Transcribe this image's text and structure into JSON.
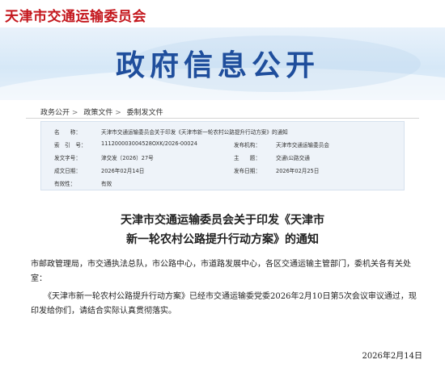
{
  "header": {
    "site_name": "天津市交通运输委员会",
    "banner_title": "政府信息公开"
  },
  "breadcrumb": {
    "items": [
      "政务公开",
      "政策文件",
      "委制发文件"
    ],
    "separator": ">"
  },
  "metadata": {
    "name_label": "名　　称：",
    "name_value": "天津市交通运输委员会关于印发《天津市新一轮农村公路提升行动方案》的通知",
    "index_label": "索　引　号：",
    "index_value": "111200003004528OXK/2026-00024",
    "issuer_label": "发布机构：",
    "issuer_value": "天津市交通运输委员会",
    "docno_label": "发文字号：",
    "docno_value": "津交发〔2026〕27号",
    "subject_label": "主　　题：",
    "subject_value": "交通\\公路交通",
    "created_label": "成文日期：",
    "created_value": "2026年02月14日",
    "published_label": "发布日期：",
    "published_value": "2026年02月25日",
    "validity_label": "有效性：",
    "validity_value": "有效"
  },
  "document": {
    "title_line1": "天津市交通运输委员会关于印发《天津市",
    "title_line2": "新一轮农村公路提升行动方案》的通知",
    "para1_line1": "市邮政管理局，市交通执法总队，市公路中心，市道路发展中心，各区交通运输主管部门，委机关各有关处",
    "para1_line2": "室：",
    "para2_line1": "《天津市新一轮农村公路提升行动方案》已经市交通运输委党委2026年2月10日第5次会议审议通过，现",
    "para2_line2": "印发给你们，请结合实际认真贯彻落实。",
    "date": "2026年2月14日"
  },
  "colors": {
    "site_name": "#c4161c",
    "banner_title": "#1f4e9c",
    "meta_background": "#eef3f9"
  }
}
